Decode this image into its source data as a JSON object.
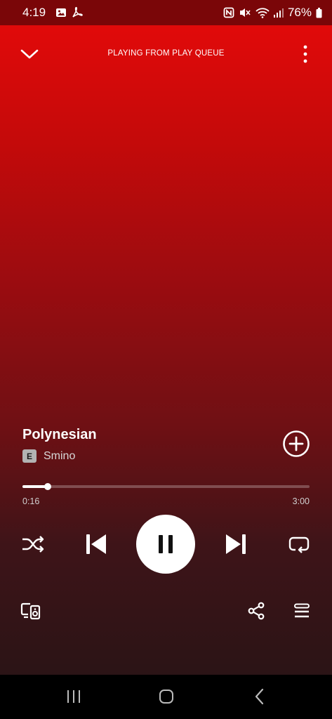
{
  "status_bar": {
    "time": "4:19",
    "left_icons": [
      "gallery-icon",
      "pdf-icon"
    ],
    "right_icons": [
      "nfc-icon",
      "mute-icon",
      "wifi-icon",
      "signal-icon"
    ],
    "battery": "76%"
  },
  "header": {
    "context_label": "PLAYING FROM PLAY QUEUE",
    "collapse_icon": "chevron-down-icon",
    "more_icon": "more-vertical-icon"
  },
  "track": {
    "title": "Polynesian",
    "explicit_badge": "E",
    "artist": "Smino",
    "add_icon": "add-circle-icon"
  },
  "progress": {
    "elapsed": "0:16",
    "total": "3:00",
    "fraction": 0.089
  },
  "controls": {
    "shuffle_icon": "shuffle-icon",
    "previous_icon": "skip-previous-icon",
    "play_pause_icon": "pause-icon",
    "next_icon": "skip-next-icon",
    "repeat_icon": "repeat-icon"
  },
  "bottom_actions": {
    "devices_icon": "connect-devices-icon",
    "share_icon": "share-icon",
    "queue_icon": "queue-icon"
  },
  "navigation_bar": {
    "recents_icon": "recents-icon",
    "home_icon": "home-icon",
    "back_icon": "back-icon"
  },
  "colors": {
    "gradient_top": "#e10a0a",
    "gradient_bottom": "#2b1416",
    "accent_white": "#ffffff"
  }
}
